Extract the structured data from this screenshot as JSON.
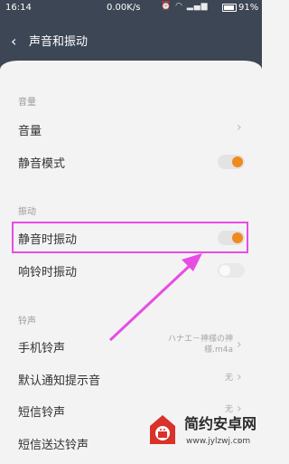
{
  "status_bar": {
    "time": "16:14",
    "network_speed": "0.00K/s",
    "icons": [
      "alarm-icon",
      "wifi-icon",
      "signal-icon"
    ],
    "battery_pct": "91%",
    "battery_level": 0.91
  },
  "header": {
    "back_icon": "‹",
    "title": "声音和振动"
  },
  "sections": {
    "volume": "音量",
    "vibration": "振动",
    "ringtone": "铃声"
  },
  "rows": {
    "volume": {
      "label": "音量",
      "chevron": "›"
    },
    "silent_mode": {
      "label": "静音模式",
      "state": "on"
    },
    "vibrate_silent": {
      "label": "静音时振动",
      "state": "on"
    },
    "vibrate_ring": {
      "label": "响铃时振动",
      "state": "off"
    },
    "phone_ringtone": {
      "label": "手机铃声",
      "value_line1": "ハナエ－神様の神",
      "value_line2": "様.m4a",
      "chevron": "›"
    },
    "notification_tone": {
      "label": "默认通知提示音",
      "value": "无",
      "chevron": "›"
    },
    "sms_tone": {
      "label": "短信铃声",
      "value": "无",
      "chevron": "›"
    },
    "sms_sent_tone": {
      "label": "短信送达铃声",
      "chevron": "›"
    }
  },
  "watermark": {
    "name": "简约安卓网",
    "url": "www.jylzwj.com"
  },
  "colors": {
    "accent": "#f08a1d",
    "header_bg": "#3c4654",
    "highlight": "#e84ce4"
  }
}
